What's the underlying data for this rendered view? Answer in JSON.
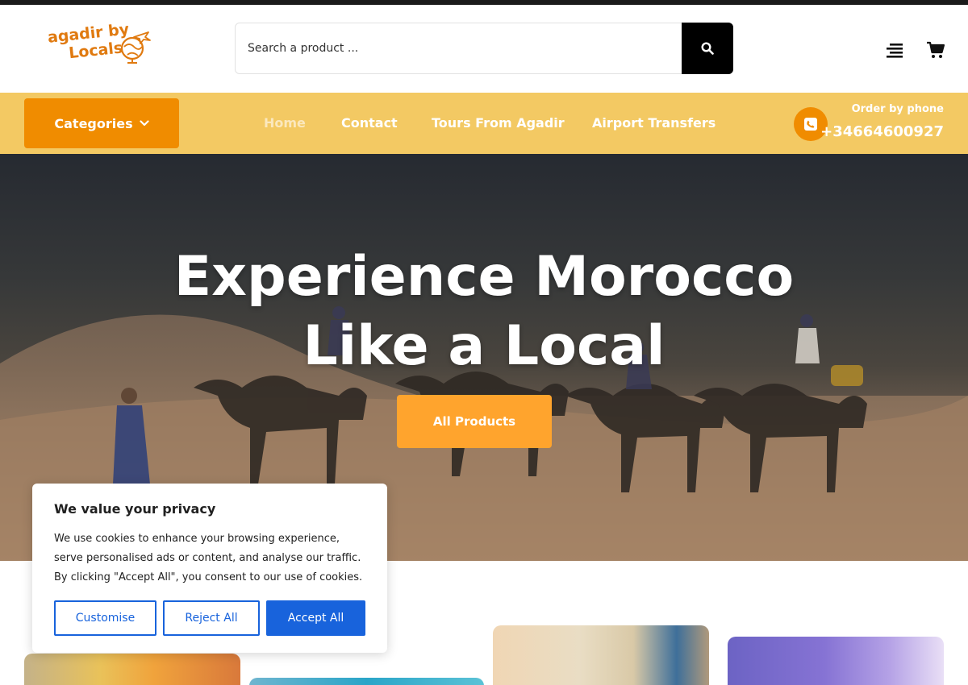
{
  "header": {
    "logo_line1": "agadir by",
    "logo_line2": "Locals",
    "search_placeholder": "Search a product ...",
    "icons": {
      "search": "search-icon",
      "menu": "menu-lines-icon",
      "cart": "cart-icon",
      "globe": "globe-plane-icon"
    }
  },
  "nav": {
    "categories_label": "Categories",
    "links": [
      {
        "label": "Home",
        "active": true
      },
      {
        "label": "Contact"
      },
      {
        "label": "Tours From Agadir"
      },
      {
        "label": "Airport Transfers"
      }
    ],
    "order_label": "Order by phone",
    "phone": "+34664600927",
    "icons": {
      "chevron": "chevron-down-icon",
      "phone": "phone-icon"
    }
  },
  "hero": {
    "title_line1": "Experience Morocco",
    "title_line2": "Like a Local",
    "button_label": "All Products"
  },
  "cookie": {
    "title": "We value your privacy",
    "text": "We use cookies to enhance your browsing experience, serve personalised ads or content, and analyse our traffic. By clicking \"Accept All\", you consent to our use of cookies.",
    "customise_label": "Customise",
    "reject_label": "Reject All",
    "accept_label": "Accept All"
  },
  "colors": {
    "brand_orange": "#f08c00",
    "nav_yellow": "#f3c963",
    "hero_button": "#ffa42d",
    "cookie_blue": "#1863dc"
  }
}
